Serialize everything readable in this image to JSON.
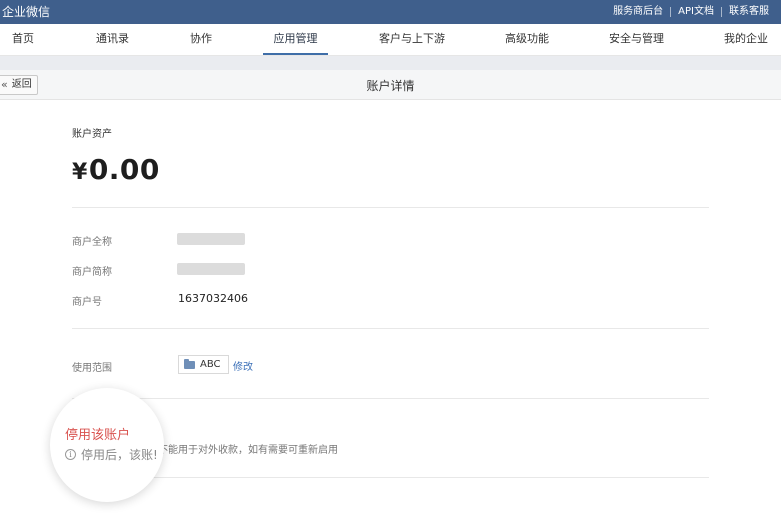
{
  "topbar": {
    "brand": "企业微信",
    "links": [
      "服务商后台",
      "API文档",
      "联系客服"
    ]
  },
  "nav": {
    "items": [
      "首页",
      "通讯录",
      "协作",
      "应用管理",
      "客户与上下游",
      "高级功能",
      "安全与管理",
      "我的企业"
    ],
    "active": "应用管理"
  },
  "subheader": {
    "back_label": "返回",
    "title": "账户详情"
  },
  "account": {
    "assets_label": "账户资产",
    "currency": "¥",
    "balance": "0.00",
    "fields": [
      {
        "label": "商户全称",
        "value": ""
      },
      {
        "label": "商户简称",
        "value": ""
      },
      {
        "label": "商户号",
        "value": "1637032406"
      }
    ],
    "scope_label": "使用范围",
    "scope_value": "ABC",
    "edit_label": "修改"
  },
  "disable": {
    "title": "停用该账户",
    "note_visible_left": "停用后，该账!",
    "note_visible_right": "不能用于对外收款，如有需要可重新启用"
  },
  "colors": {
    "topbar": "#3f5f8c",
    "link": "#3b70b8",
    "danger": "#d9534f"
  }
}
